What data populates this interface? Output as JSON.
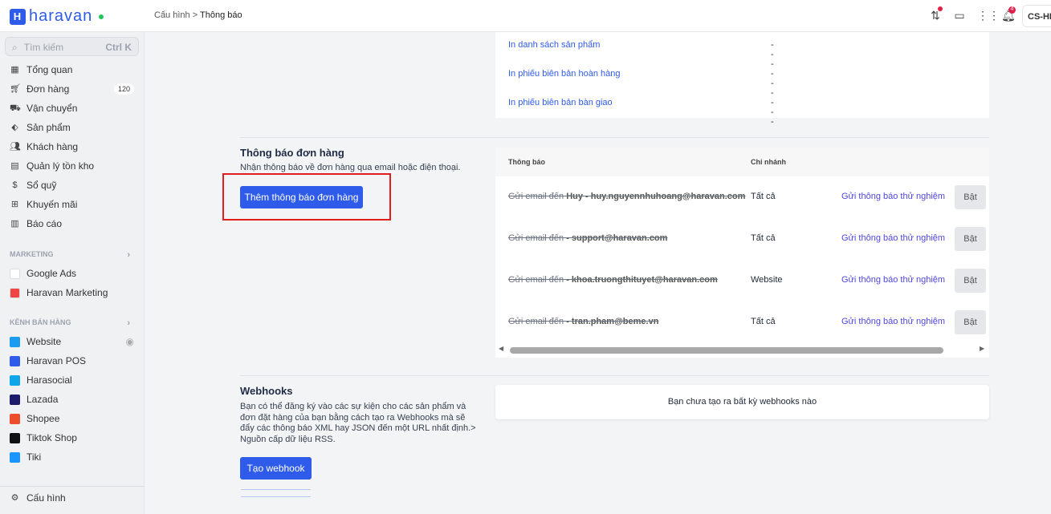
{
  "header": {
    "brand": "haravan",
    "breadcrumb": [
      "Cấu hình",
      "Thông báo"
    ],
    "notification_count": "4",
    "store": "CS-HR"
  },
  "sidebar": {
    "search_placeholder": "Tìm kiếm",
    "search_shortcut": "Ctrl K",
    "items": [
      {
        "label": "Tổng quan",
        "icon": "dashboard-icon"
      },
      {
        "label": "Đơn hàng",
        "icon": "cart-icon",
        "count": "120"
      },
      {
        "label": "Vận chuyển",
        "icon": "truck-icon"
      },
      {
        "label": "Sản phẩm",
        "icon": "tag-icon"
      },
      {
        "label": "Khách hàng",
        "icon": "users-icon"
      },
      {
        "label": "Quản lý tồn kho",
        "icon": "box-icon"
      },
      {
        "label": "Sổ quỹ",
        "icon": "dollar-icon"
      },
      {
        "label": "Khuyến mãi",
        "icon": "gift-icon"
      },
      {
        "label": "Báo cáo",
        "icon": "chart-icon"
      }
    ],
    "marketing_title": "MARKETING",
    "marketing": [
      {
        "label": "Google Ads",
        "color": "#ffffff"
      },
      {
        "label": "Haravan Marketing",
        "color": "#ef4444"
      }
    ],
    "channels_title": "KÊNH BÁN HÀNG",
    "channels": [
      {
        "label": "Website",
        "color": "#1d9bf0"
      },
      {
        "label": "Haravan POS",
        "color": "#2f5bea"
      },
      {
        "label": "Harasocial",
        "color": "#0ea5e9"
      },
      {
        "label": "Lazada",
        "color": "#1e1b6b"
      },
      {
        "label": "Shopee",
        "color": "#ee4d2d"
      },
      {
        "label": "Tiktok Shop",
        "color": "#111111"
      },
      {
        "label": "Tiki",
        "color": "#1a94ff"
      }
    ],
    "settings": "Cấu hình"
  },
  "print_rows": [
    {
      "label": "In danh sách sản phẩm",
      "value": "---"
    },
    {
      "label": "In phiếu biên bản hoàn hàng",
      "value": "---"
    },
    {
      "label": "In phiếu biên bản bàn giao",
      "value": "---"
    }
  ],
  "order_notify": {
    "title": "Thông báo đơn hàng",
    "desc": "Nhận thông báo về đơn hàng qua email hoặc điện thoại.",
    "add_button": "Thêm thông báo đơn hàng",
    "columns": [
      "Thông báo",
      "Chi nhánh"
    ],
    "rows": [
      {
        "prefix": "Gửi email đến",
        "name": "Huy - huy.nguyennhuhoang@haravan.com",
        "branch": "Tất cả",
        "test": "Gửi thông báo thử nghiệm",
        "toggle": "Bật"
      },
      {
        "prefix": "Gửi email đến",
        "name": "- support@haravan.com",
        "branch": "Tất cả",
        "test": "Gửi thông báo thử nghiệm",
        "toggle": "Bật"
      },
      {
        "prefix": "Gửi email đến",
        "name": "- khoa.truongthituyet@haravan.com",
        "branch": "Website",
        "test": "Gửi thông báo thử nghiệm",
        "toggle": "Bật"
      },
      {
        "prefix": "Gửi email đến",
        "name": "- tran.pham@beme.vn",
        "branch": "Tất cả",
        "test": "Gửi thông báo thử nghiệm",
        "toggle": "Bật"
      }
    ]
  },
  "webhooks": {
    "title": "Webhooks",
    "desc": "Bạn có thể đăng ký vào các sự kiện cho các sản phẩm và đơn đặt hàng của bạn bằng cách tạo ra Webhooks mà sẽ đẩy các thông báo XML hay JSON đến một URL nhất định.> Nguồn cấp dữ liệu RSS.",
    "create_button": "Tạo webhook",
    "empty": "Bạn chưa tạo ra bất kỳ webhooks nào"
  }
}
